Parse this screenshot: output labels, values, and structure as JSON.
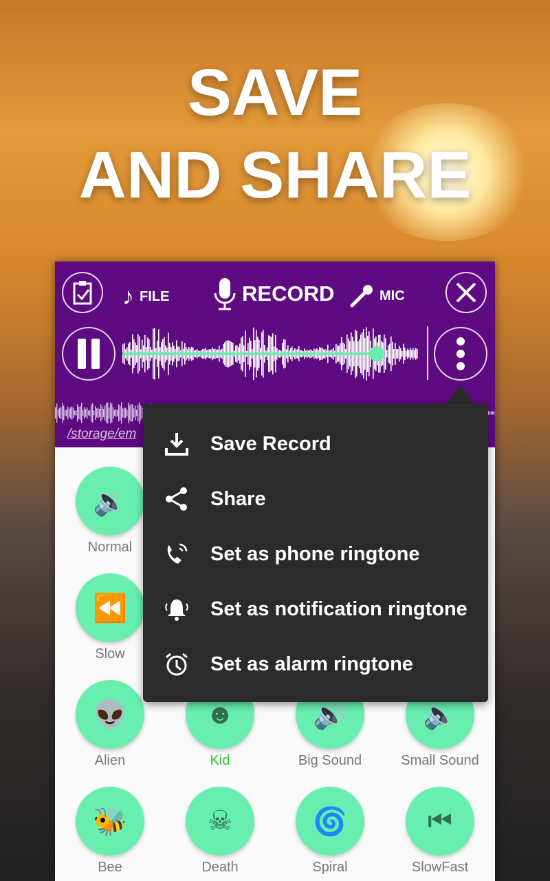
{
  "promo": {
    "line1": "SAVE",
    "line2": "AND SHARE"
  },
  "header": {
    "file_label": "FILE",
    "record_label": "RECORD",
    "mic_label": "MIC",
    "path": "/storage/em",
    "progress": 0.86
  },
  "colors": {
    "header": "#5e0a80",
    "accent": "#68efb0",
    "menu": "#2b2b2b",
    "selected": "#22cc22"
  },
  "menu": {
    "items": [
      {
        "label": "Save Record",
        "icon": "download-icon"
      },
      {
        "label": "Share",
        "icon": "share-icon"
      },
      {
        "label": "Set as phone ringtone",
        "icon": "phone-ring-icon"
      },
      {
        "label": "Set as notification ringtone",
        "icon": "bell-icon"
      },
      {
        "label": "Set as alarm ringtone",
        "icon": "alarm-icon"
      }
    ]
  },
  "effects": [
    {
      "label": "Normal",
      "icon": "speaker-icon"
    },
    {
      "label": "Slow",
      "icon": "rewind-icon"
    },
    {
      "label": "Alien",
      "icon": "alien-icon"
    },
    {
      "label": "Kid",
      "icon": "smiley-icon",
      "selected": true
    },
    {
      "label": "Big Sound",
      "icon": "speaker-loud-icon"
    },
    {
      "label": "Small Sound",
      "icon": "speaker-low-icon"
    },
    {
      "label": "Bee",
      "icon": "bee-icon"
    },
    {
      "label": "Death",
      "icon": "skull-icon"
    },
    {
      "label": "Spiral",
      "icon": "spiral-icon"
    },
    {
      "label": "SlowFast",
      "icon": "slowfast-icon"
    }
  ]
}
